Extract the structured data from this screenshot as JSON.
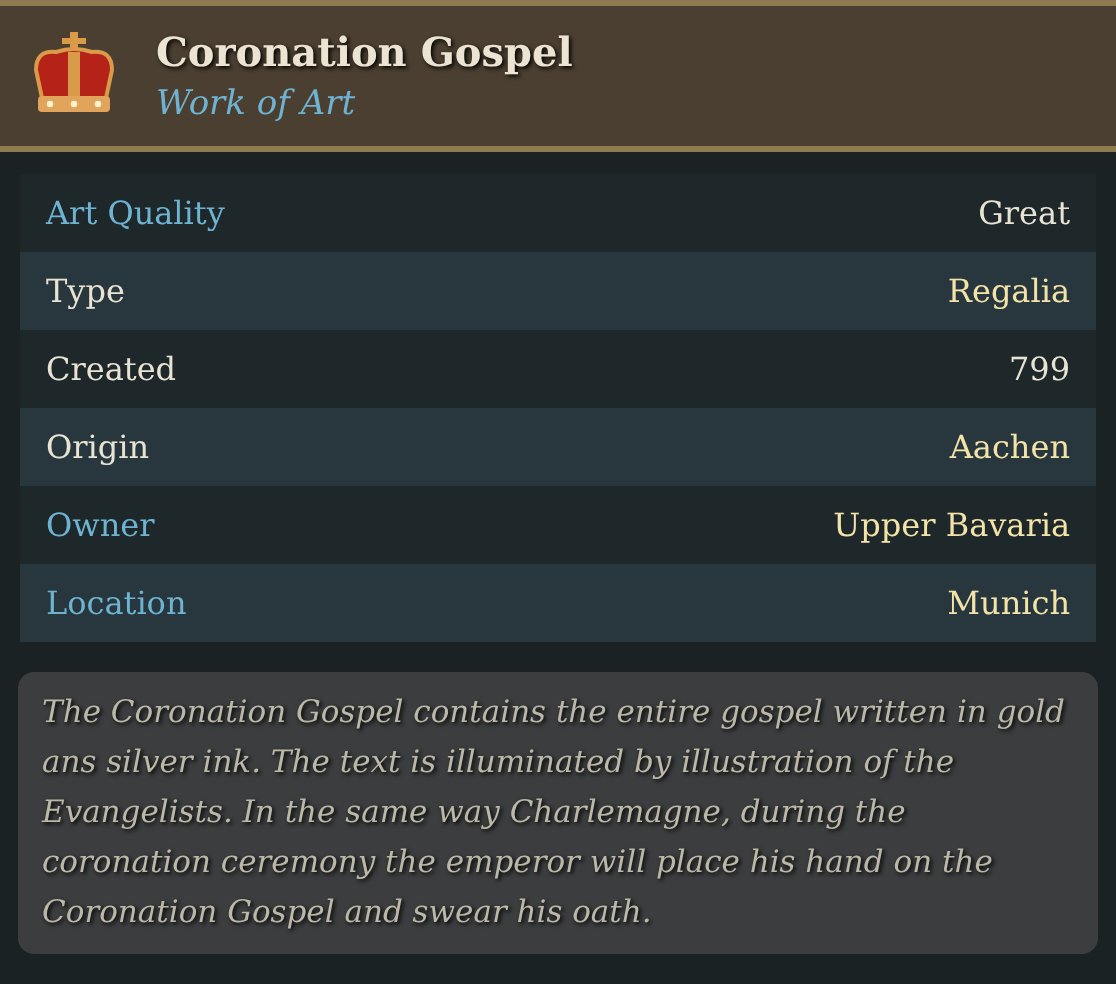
{
  "header": {
    "title": "Coronation Gospel",
    "subtitle": "Work of Art"
  },
  "rows": [
    {
      "label": {
        "text": "Art Quality",
        "color": "#6fb3d2"
      },
      "value": {
        "text": "Great",
        "color": "#e8e3d3"
      }
    },
    {
      "label": {
        "text": "Type",
        "color": "#e8e3d3"
      },
      "value": {
        "text": "Regalia",
        "color": "#f3e3a8"
      }
    },
    {
      "label": {
        "text": "Created",
        "color": "#e8e3d3"
      },
      "value": {
        "text": "799",
        "color": "#e8e3d3"
      }
    },
    {
      "label": {
        "text": "Origin",
        "color": "#e8e3d3"
      },
      "value": {
        "text": "Aachen",
        "color": "#f3e3a8"
      }
    },
    {
      "label": {
        "text": "Owner",
        "color": "#6fb3d2"
      },
      "value": {
        "text": "Upper Bavaria",
        "color": "#f3e3a8"
      }
    },
    {
      "label": {
        "text": "Location",
        "color": "#6fb3d2"
      },
      "value": {
        "text": "Munich",
        "color": "#f3e3a8"
      }
    }
  ],
  "description": "The Coronation Gospel contains the entire gospel written in gold ans silver ink. The text is illuminated by illustration of the Evangelists. In the same way Charlemagne, during the coronation ceremony the emperor will place his hand on the Coronation Gospel and swear his oath."
}
